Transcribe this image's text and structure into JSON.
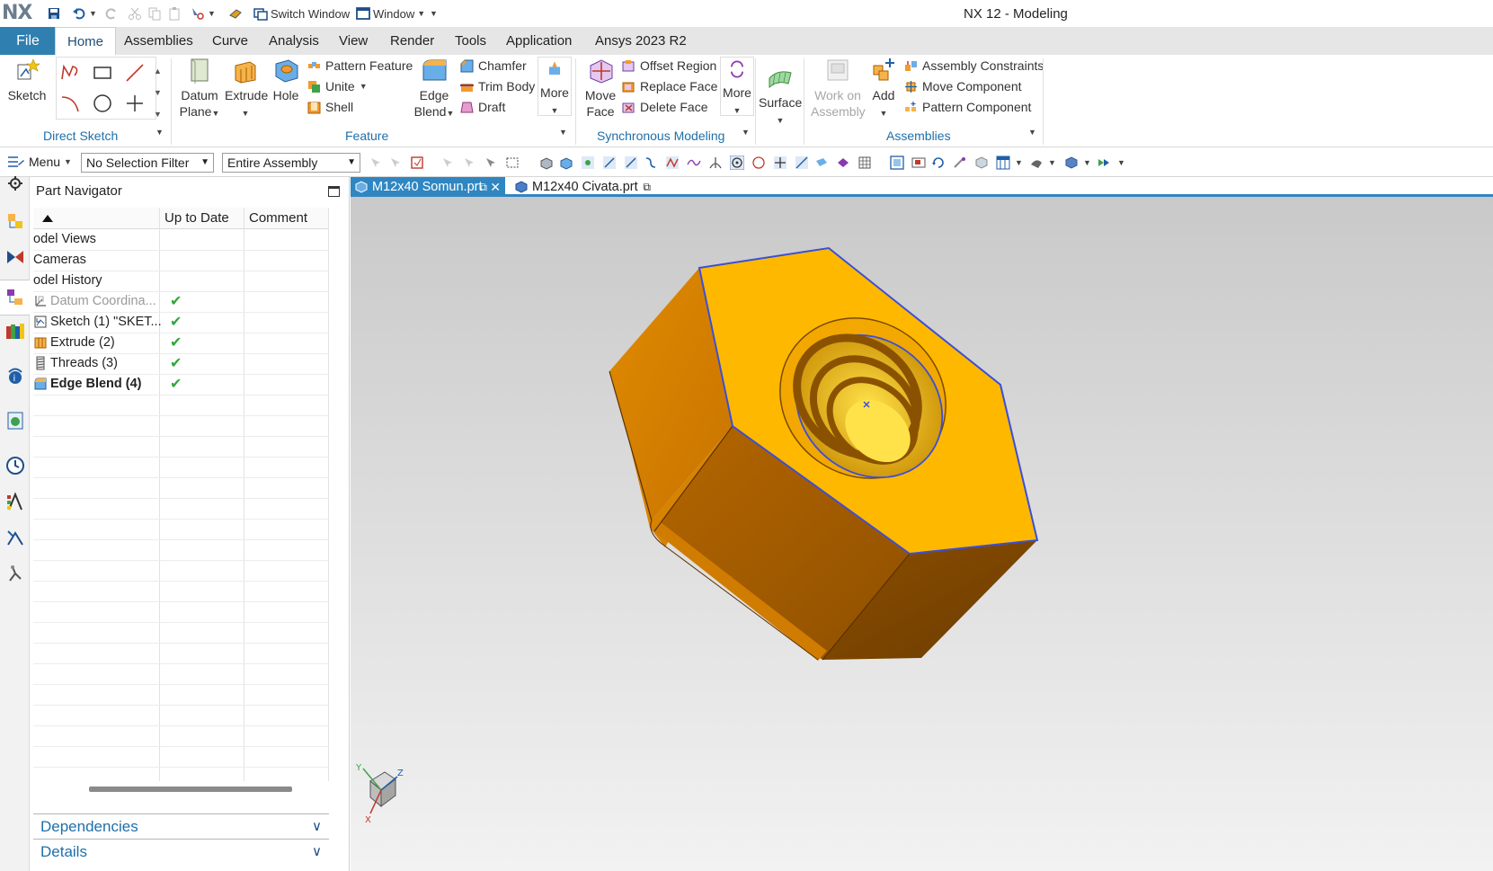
{
  "app": {
    "logo": "NX",
    "title": "NX 12 - Modeling"
  },
  "quick_access": {
    "switch_window": "Switch Window",
    "window": "Window"
  },
  "ribbon_tabs": [
    "File",
    "Home",
    "Assemblies",
    "Curve",
    "Analysis",
    "View",
    "Render",
    "Tools",
    "Application",
    "Ansys 2023 R2"
  ],
  "ribbon": {
    "direct_sketch": {
      "label": "Direct Sketch",
      "sketch": "Sketch"
    },
    "feature": {
      "label": "Feature",
      "datum_plane": [
        "Datum",
        "Plane"
      ],
      "extrude": "Extrude",
      "hole": "Hole",
      "pattern_feature": "Pattern Feature",
      "unite": "Unite",
      "shell": "Shell",
      "edge_blend": [
        "Edge",
        "Blend"
      ],
      "chamfer": "Chamfer",
      "trim_body": "Trim Body",
      "draft": "Draft",
      "more": "More"
    },
    "sync": {
      "label": "Synchronous Modeling",
      "move_face": [
        "Move",
        "Face"
      ],
      "offset_region": "Offset Region",
      "replace_face": "Replace Face",
      "delete_face": "Delete Face",
      "more": "More"
    },
    "surface": {
      "label": "Surface"
    },
    "assemblies": {
      "label": "Assemblies",
      "work_on_assembly": [
        "Work on",
        "Assembly"
      ],
      "add": "Add",
      "assembly_constraints": "Assembly Constraints",
      "move_component": "Move Component",
      "pattern_component": "Pattern Component"
    }
  },
  "cmdbar": {
    "menu": "Menu",
    "selection_filter": "No Selection Filter",
    "scope": "Entire Assembly"
  },
  "navigator": {
    "title": "Part Navigator",
    "columns": [
      "Up to Date",
      "Comment"
    ],
    "rows": [
      {
        "name": "odel Views",
        "uptodate": ""
      },
      {
        "name": "Cameras",
        "uptodate": ""
      },
      {
        "name": "odel History",
        "uptodate": ""
      },
      {
        "name": "Datum Coordina...",
        "uptodate": "✔"
      },
      {
        "name": "Sketch (1) \"SKET...",
        "uptodate": "✔"
      },
      {
        "name": "Extrude (2)",
        "uptodate": "✔"
      },
      {
        "name": "Threads (3)",
        "uptodate": "✔"
      },
      {
        "name": "Edge Blend (4)",
        "uptodate": "✔"
      }
    ],
    "dependencies": "Dependencies",
    "details": "Details"
  },
  "doc_tabs": [
    {
      "label": "M12x40 Somun.prt",
      "active": true
    },
    {
      "label": "M12x40 Civata.prt",
      "active": false
    }
  ],
  "viewport": {
    "model_color": "#ffb800",
    "edge_color": "#3b4fd6",
    "triad": {
      "x": "X",
      "y": "Y",
      "z": "Z"
    }
  }
}
